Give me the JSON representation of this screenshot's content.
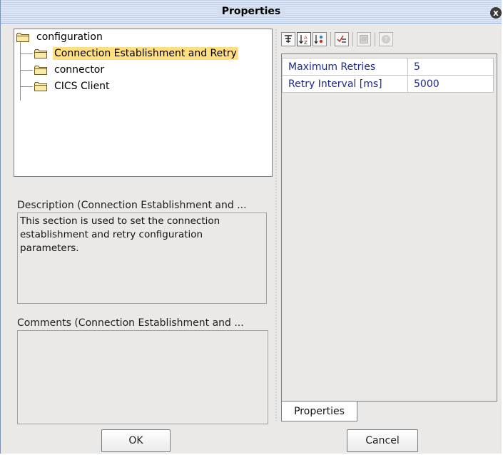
{
  "window": {
    "title": "Properties",
    "close_symbol": "x"
  },
  "tree": {
    "root": "configuration",
    "children": [
      {
        "label": "Connection Establishment and Retry",
        "selected": true
      },
      {
        "label": "connector",
        "selected": false
      },
      {
        "label": "CICS Client",
        "selected": false
      }
    ]
  },
  "description": {
    "label": "Description (Connection Establishment and ...",
    "text": "This section is used to set the connection establishment and retry configuration parameters."
  },
  "comments": {
    "label": "Comments (Connection Establishment and ...",
    "text": ""
  },
  "toolbar": {
    "buttons": [
      {
        "icon": "categorized-icon",
        "glyph": "✱"
      },
      {
        "icon": "sort-alphabetical-icon",
        "glyph": "↓"
      },
      {
        "icon": "sort-category-icon",
        "glyph": "⇅"
      },
      {
        "icon": "checklist-icon",
        "glyph": "✓"
      },
      {
        "icon": "description-icon",
        "glyph": "▤"
      },
      {
        "icon": "help-icon",
        "glyph": "?"
      }
    ]
  },
  "properties": {
    "rows": [
      {
        "name": "Maximum Retries",
        "value": "5"
      },
      {
        "name": "Retry Interval [ms]",
        "value": "5000"
      }
    ],
    "tab_label": "Properties"
  },
  "buttons": {
    "ok": "OK",
    "cancel": "Cancel"
  },
  "colors": {
    "selection": "#ffdf80",
    "key_text": "#1b2a8a"
  }
}
